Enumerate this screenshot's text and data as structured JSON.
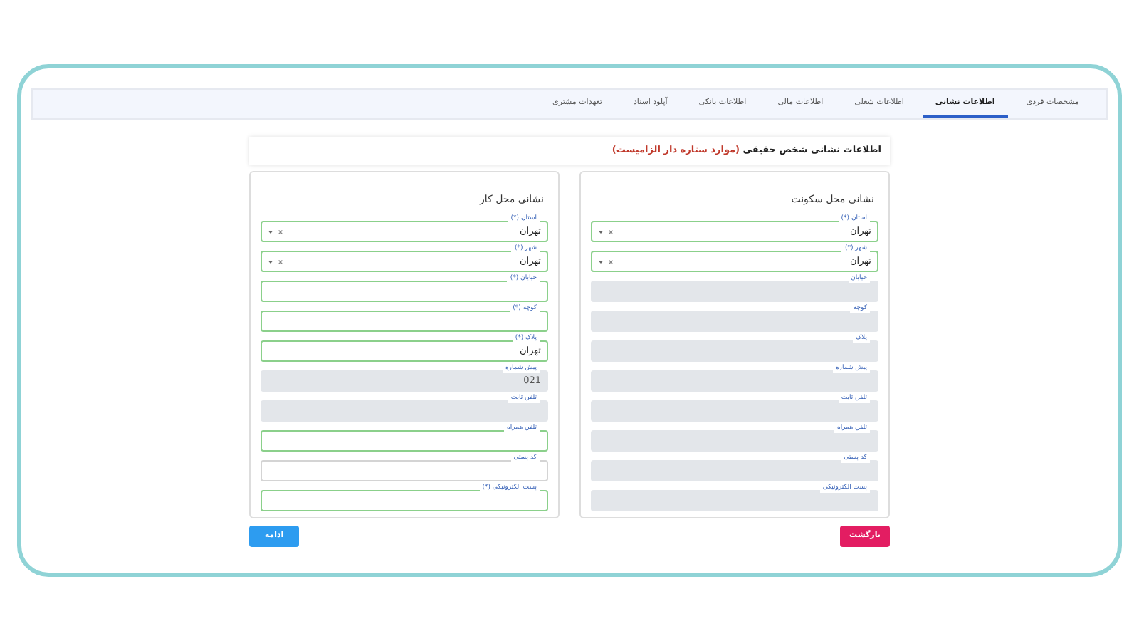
{
  "tabs": [
    {
      "label": "مشخصات فردی",
      "selected": false
    },
    {
      "label": "اطلاعات نشانی",
      "selected": true
    },
    {
      "label": "اطلاعات شغلی",
      "selected": false
    },
    {
      "label": "اطلاعات مالی",
      "selected": false
    },
    {
      "label": "اطلاعات بانکی",
      "selected": false
    },
    {
      "label": "آپلود اسناد",
      "selected": false
    },
    {
      "label": "تعهدات مشتری",
      "selected": false
    }
  ],
  "header": {
    "title": "اطلاعات نشانی شخص حقیقی",
    "note": "(موارد ستاره دار الزامیست)"
  },
  "panels": [
    {
      "title": "نشانی محل سکونت",
      "fields": [
        {
          "label": "استان (*)",
          "kind": "select",
          "valid": true,
          "disabled": false,
          "value": "تهران"
        },
        {
          "label": "شهر (*)",
          "kind": "select",
          "valid": true,
          "disabled": false,
          "value": "تهران"
        },
        {
          "label": "خیابان",
          "kind": "text",
          "valid": false,
          "disabled": true
        },
        {
          "label": "کوچه",
          "kind": "text",
          "valid": false,
          "disabled": true
        },
        {
          "label": "پلاک",
          "kind": "text",
          "valid": false,
          "disabled": true
        },
        {
          "label": "پیش شماره",
          "kind": "text",
          "valid": false,
          "disabled": true
        },
        {
          "label": "تلفن ثابت",
          "kind": "text",
          "valid": false,
          "disabled": true
        },
        {
          "label": "تلفن همراه",
          "kind": "text",
          "valid": false,
          "disabled": true
        },
        {
          "label": "کد پستی",
          "kind": "text",
          "valid": false,
          "disabled": true
        },
        {
          "label": "پست الکترونیکی",
          "kind": "text",
          "valid": false,
          "disabled": true
        }
      ]
    },
    {
      "title": "نشانی محل کار",
      "fields": [
        {
          "label": "استان (*)",
          "kind": "select",
          "valid": true,
          "disabled": false,
          "value": "تهران"
        },
        {
          "label": "شهر (*)",
          "kind": "select",
          "valid": true,
          "disabled": false,
          "value": "تهران"
        },
        {
          "label": "خیابان (*)",
          "kind": "text",
          "valid": true,
          "disabled": false
        },
        {
          "label": "کوچه (*)",
          "kind": "text",
          "valid": true,
          "disabled": false
        },
        {
          "label": "پلاک (*)",
          "kind": "text",
          "valid": true,
          "disabled": false,
          "value": "تهران"
        },
        {
          "label": "پیش شماره",
          "kind": "text",
          "valid": false,
          "disabled": true,
          "value": "021"
        },
        {
          "label": "تلفن ثابت",
          "kind": "text",
          "valid": false,
          "disabled": true
        },
        {
          "label": "تلفن همراه",
          "kind": "text",
          "valid": true,
          "disabled": false
        },
        {
          "label": "کد پستی",
          "kind": "text",
          "valid": false,
          "disabled": false
        },
        {
          "label": "پست الکترونیکی (*)",
          "kind": "text",
          "valid": true,
          "disabled": false
        }
      ]
    }
  ],
  "buttons": [
    {
      "label": "بازگشت",
      "kind": "back"
    },
    {
      "label": "ادامه",
      "kind": "next"
    }
  ]
}
